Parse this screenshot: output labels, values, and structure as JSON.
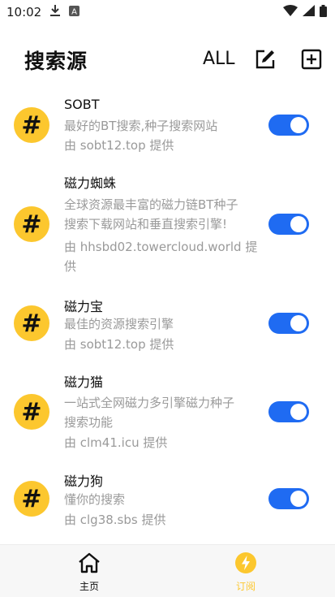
{
  "status_bar": {
    "time": "10:02",
    "icons": [
      "download-icon",
      "a-notification-icon",
      "wifi-icon",
      "signal-icon",
      "battery-icon"
    ]
  },
  "header": {
    "title": "搜索源",
    "all_label": "ALL",
    "edit_icon": "edit-icon",
    "add_icon": "add-box-icon"
  },
  "sources": [
    {
      "badge": "#",
      "name": "SOBT",
      "description": [
        "最好的BT搜索,种子搜索网站"
      ],
      "provider": "由 sobt12.top 提供",
      "enabled": true
    },
    {
      "badge": "#",
      "name": "磁力蜘蛛",
      "description": [
        "全球资源最丰富的磁力链BT种子",
        "搜索下载网站和垂直搜索引擎!"
      ],
      "provider": [
        "由 hhsbd02.towercloud.world 提",
        "供"
      ],
      "enabled": true
    },
    {
      "badge": "#",
      "name": "磁力宝",
      "description": [
        "最佳的资源搜索引擎"
      ],
      "provider": "由 sobt12.top 提供",
      "enabled": true
    },
    {
      "badge": "#",
      "name": "磁力猫",
      "description": [
        "一站式全网磁力多引擎磁力种子",
        "搜索功能"
      ],
      "provider": "由 clm41.icu 提供",
      "enabled": true
    },
    {
      "badge": "#",
      "name": "磁力狗",
      "description": [
        "懂你的搜索"
      ],
      "provider": "由 clg38.sbs 提供",
      "enabled": true
    }
  ],
  "bottom_nav": [
    {
      "label": "主页",
      "icon": "home-icon",
      "active": false
    },
    {
      "label": "订阅",
      "icon": "lightning-icon",
      "active": true
    }
  ],
  "colors": {
    "accent": "#fcc72e",
    "toggle_on": "#1f6bf2",
    "secondary_text": "#9a9a9a"
  }
}
